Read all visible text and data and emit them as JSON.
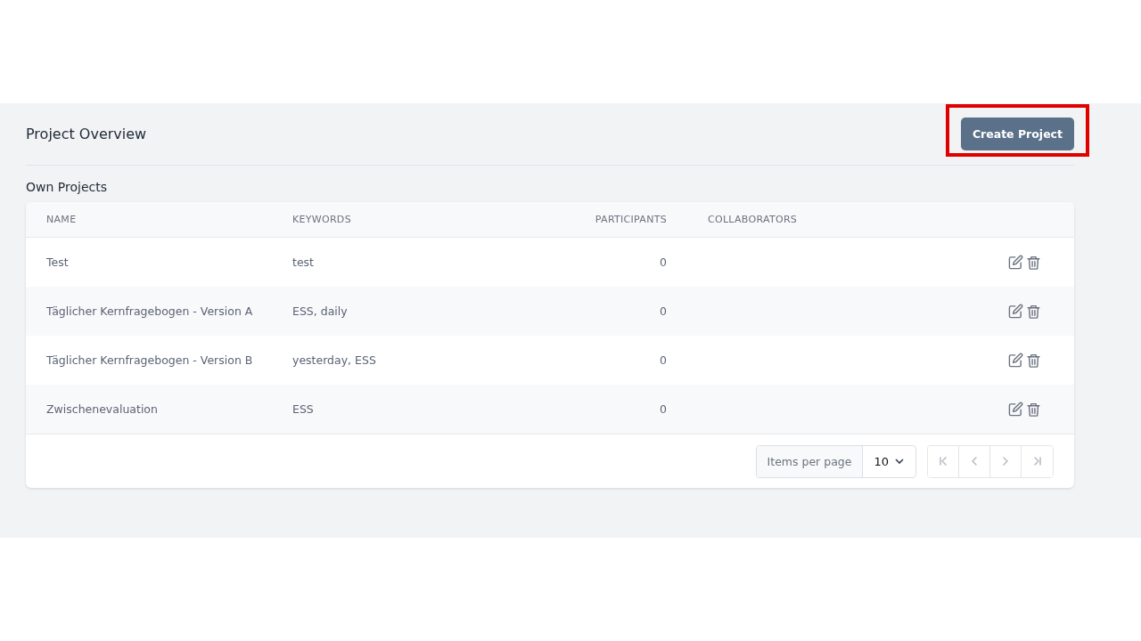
{
  "header": {
    "title": "Project Overview",
    "create_button": {
      "label": "Create Project",
      "highlighted": true
    }
  },
  "section_title": "Own Projects",
  "table": {
    "columns": [
      "NAME",
      "KEYWORDS",
      "PARTICIPANTS",
      "COLLABORATORS"
    ],
    "rows": [
      {
        "name": "Test",
        "keywords": "test",
        "participants": "0"
      },
      {
        "name": "Täglicher Kernfragebogen - Version A",
        "keywords": "ESS, daily",
        "participants": "0"
      },
      {
        "name": "Täglicher Kernfragebogen - Version B",
        "keywords": "yesterday, ESS",
        "participants": "0"
      },
      {
        "name": "Zwischenevaluation",
        "keywords": "ESS",
        "participants": "0"
      }
    ]
  },
  "pagination": {
    "items_per_page_label": "Items per page",
    "items_per_page": "10",
    "buttons": [
      {
        "kind": "first",
        "disabled": true
      },
      {
        "kind": "prev",
        "disabled": true
      },
      {
        "kind": "next",
        "disabled": true
      },
      {
        "kind": "last",
        "disabled": true
      }
    ]
  }
}
